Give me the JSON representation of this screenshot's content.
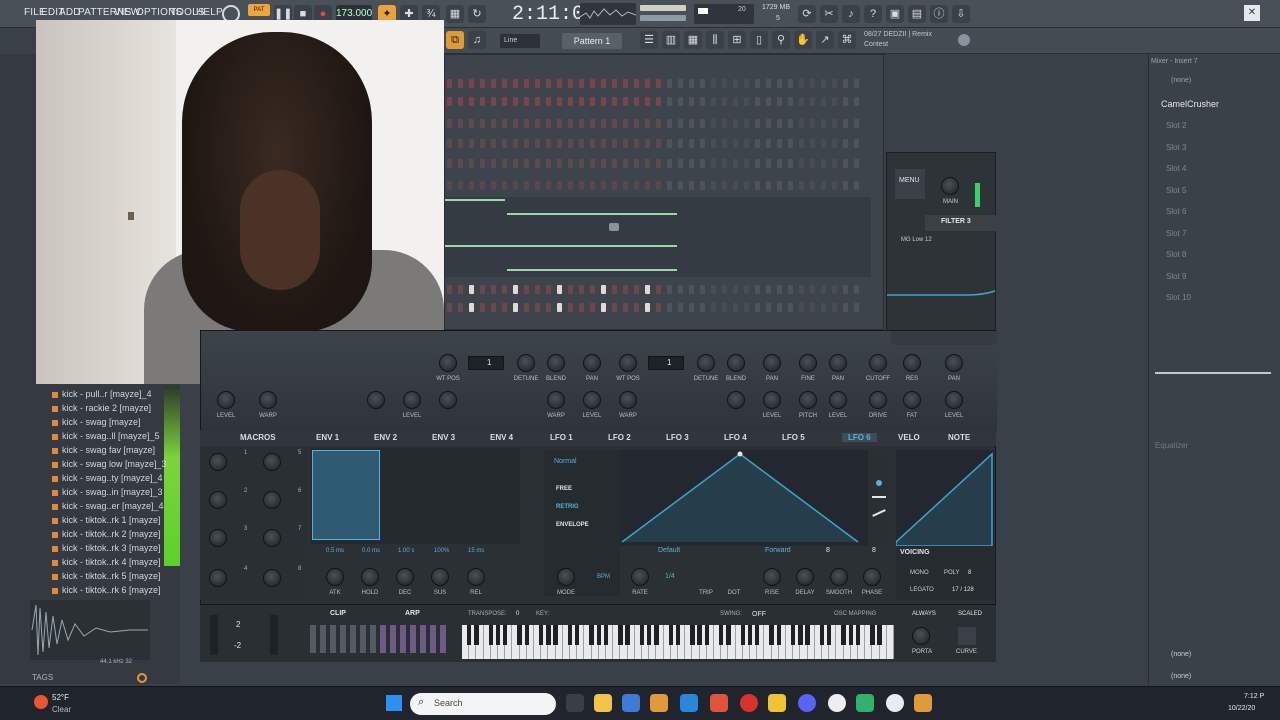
{
  "menubar": {
    "items": [
      "FILE",
      "EDIT",
      "ADD",
      "PATTERNS",
      "VIEW",
      "OPTIONS",
      "TOOLS",
      "HELP"
    ],
    "tempo": "173.000",
    "time": "2:11:04",
    "memory": "1729 MB",
    "cpu_count": "5",
    "cpu_top": "20",
    "pattern": "Pattern 1",
    "snap": "Line",
    "hint_line1": "08/27 DEDZII | Remix",
    "hint_line2": "Contest"
  },
  "browser": {
    "items": [
      "kick - pull..r [mayze]_4",
      "kick - rackie 2 [mayze]",
      "kick - swag [mayze]",
      "kick - swag..ll [mayze]_5",
      "kick - swag fav [mayze]",
      "kick - swag low [mayze]_3",
      "kick - swag..ty [mayze]_4",
      "kick - swag..in [mayze]_3",
      "kick - swag..er [mayze]_4",
      "kick - tiktok..rk 1 [mayze]",
      "kick - tiktok..rk 2 [mayze]",
      "kick - tiktok..rk 3 [mayze]",
      "kick - tiktok..rk 4 [mayze]",
      "kick - tiktok..rk 5 [mayze]",
      "kick - tiktok..rk 6 [mayze]"
    ],
    "tags_label": "TAGS",
    "sample_info": "44.1 kHz 32"
  },
  "serum": {
    "tabs": [
      "MACROS",
      "ENV 1",
      "ENV 2",
      "ENV 3",
      "ENV 4",
      "LFO 1",
      "LFO 2",
      "LFO 3",
      "LFO 4",
      "LFO 5",
      "LFO 6",
      "VELO",
      "NOTE"
    ],
    "active_tab": "LFO 6",
    "osc_labels": [
      "WT POS",
      "UNISON",
      "DETUNE",
      "BLEND",
      "PAN",
      "WT POS",
      "UNISON",
      "DETUNE",
      "BLEND",
      "PAN",
      "FINE",
      "PAN",
      "CUTOFF",
      "RES",
      "PAN"
    ],
    "osc_labels2": [
      "LEVEL",
      "WARP",
      "LEVEL",
      "WARP",
      "LEVEL",
      "WARP",
      "LEVEL",
      "PITCH",
      "LEVEL",
      "DRIVE",
      "FAT",
      "MIX",
      "LEVEL"
    ],
    "unison_a": "1",
    "unison_b": "1",
    "filter_name": "FILTER 3",
    "filter_type": "MG Low 12",
    "menu_label": "MENU",
    "main_label": "MAIN",
    "env_values": [
      "0.5 ms",
      "0.0 ms",
      "1.00 s",
      "100%",
      "15 ms"
    ],
    "env_knobs": [
      "ATK",
      "HOLD",
      "DEC",
      "SUS",
      "REL"
    ],
    "lfo_mode": "Normal",
    "lfo_opts": [
      "FREE",
      "RETRIG",
      "ENVELOPE"
    ],
    "lfo_preset": "Default",
    "lfo_direction": "Forward",
    "lfo_num1": "8",
    "lfo_num2": "8",
    "lfo_rate": "1/4",
    "lfo_knobs": [
      "MODE",
      "RATE",
      "TRIP",
      "DOT",
      "RISE",
      "DELAY",
      "SMOOTH",
      "PHASE"
    ],
    "bpm": "BPM",
    "voicing": {
      "title": "VOICING",
      "mono": "MONO",
      "poly": "POLY",
      "poly_value": "8",
      "legato": "LEGATO",
      "voices": "17 / 128"
    },
    "clip": "CLIP",
    "arp": "ARP",
    "transpose_label": "TRANSPOSE:",
    "transpose_value": "0",
    "key_label": "KEY:",
    "swing_label": "SWING:",
    "swing_value": "OFF",
    "osc_mapping": "OSC MAPPING",
    "always": "ALWAYS",
    "scaled": "SCALED",
    "porta": "PORTA",
    "curve": "CURVE",
    "pitch_up": "2",
    "pitch_down": "-2",
    "macro_numbers": [
      "1",
      "5",
      "2",
      "6",
      "3",
      "7",
      "4",
      "8"
    ]
  },
  "mixer": {
    "title": "Mixer - Insert 7",
    "top_slot": "(none)",
    "plugin": "CamelCrusher",
    "slots": [
      "Slot 2",
      "Slot 3",
      "Slot 4",
      "Slot 5",
      "Slot 6",
      "Slot 7",
      "Slot 8",
      "Slot 9",
      "Slot 10"
    ],
    "equalizer": "Equalizer",
    "bottom1": "(none)",
    "bottom2": "(none)"
  },
  "taskbar": {
    "weather_temp": "52°F",
    "weather_desc": "Clear",
    "search_placeholder": "Search",
    "clock_time": "7:12 P",
    "clock_date": "10/22/20"
  }
}
